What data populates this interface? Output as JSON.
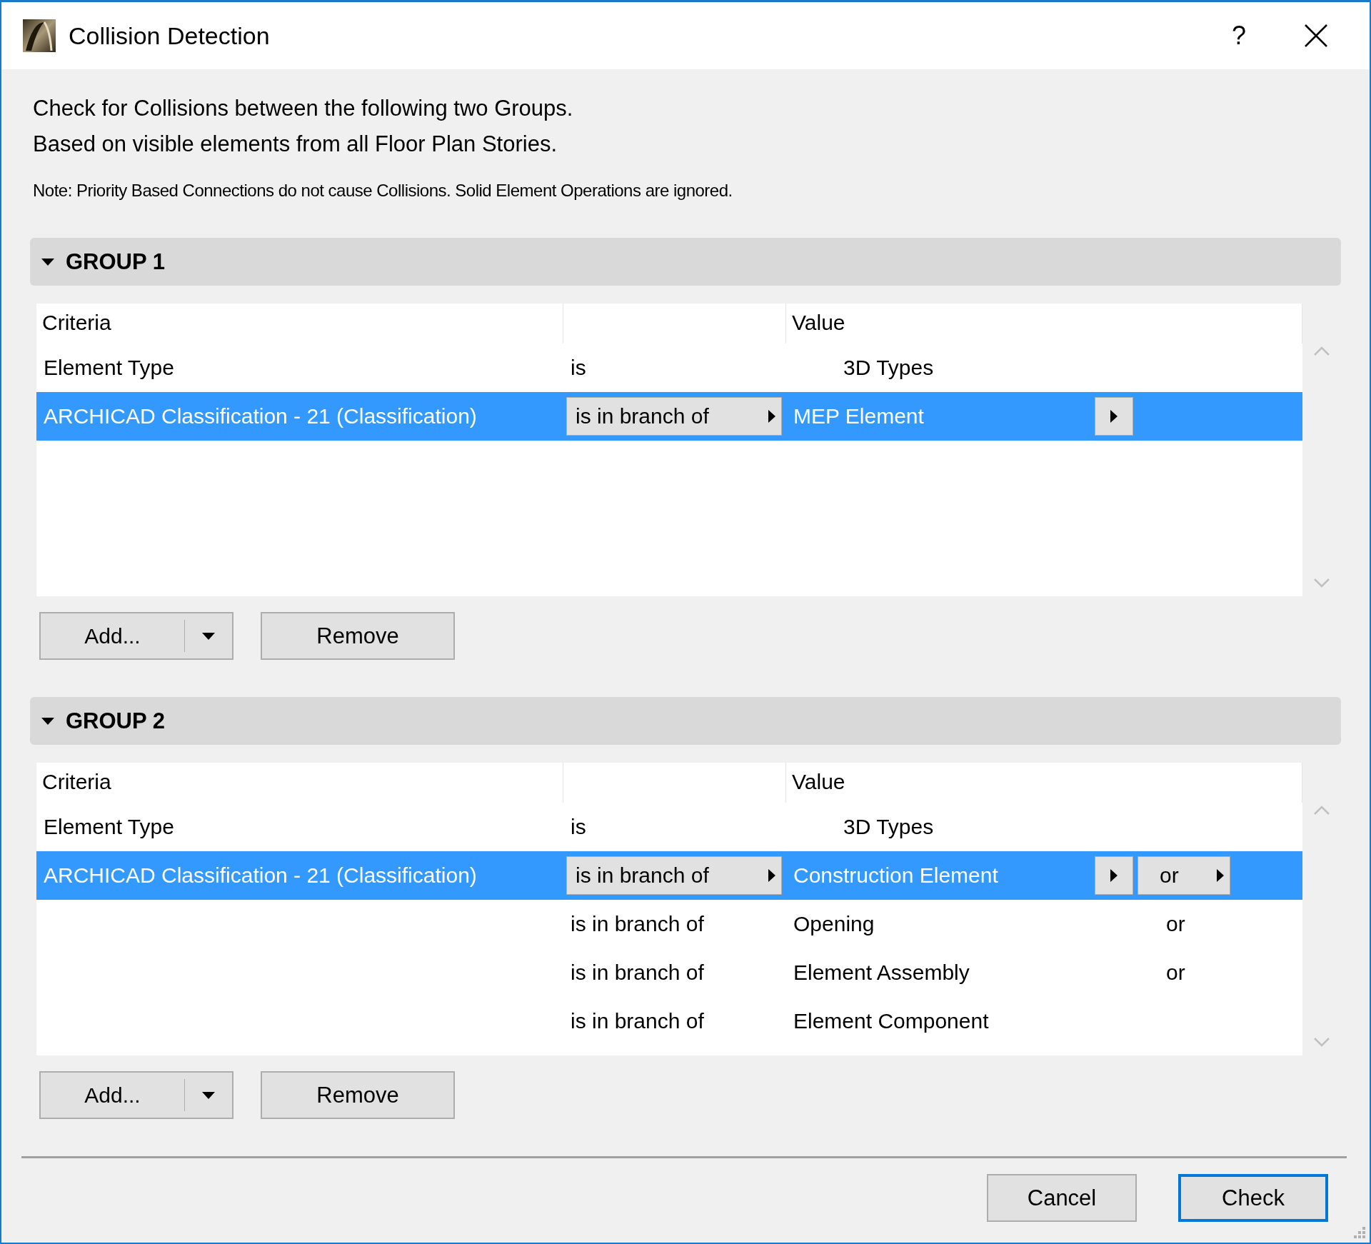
{
  "window": {
    "title": "Collision Detection",
    "help": "?"
  },
  "intro": [
    "Check for Collisions between the following two Groups.",
    "Based on visible elements from all Floor Plan Stories."
  ],
  "note": "Note: Priority Based Connections do not cause Collisions. Solid Element Operations are ignored.",
  "groups": [
    {
      "title": "GROUP 1",
      "expanded": true,
      "columns": {
        "criteria": "Criteria",
        "value": "Value"
      },
      "rows": [
        {
          "criteria": "Element Type",
          "operator": "is",
          "value": "3D Types",
          "selected": false
        },
        {
          "criteria": "ARCHICAD Classification - 21 (Classification)",
          "operator": "is in branch of",
          "value": "MEP Element",
          "selected": true
        }
      ],
      "add": "Add...",
      "remove": "Remove"
    },
    {
      "title": "GROUP 2",
      "expanded": true,
      "columns": {
        "criteria": "Criteria",
        "value": "Value"
      },
      "rows": [
        {
          "criteria": "Element Type",
          "operator": "is",
          "value": "3D Types",
          "selected": false
        },
        {
          "criteria": "ARCHICAD Classification - 21 (Classification)",
          "operator": "is in branch of",
          "value": "Construction Element",
          "conjunction": "or",
          "selected": true
        },
        {
          "operator": "is in branch of",
          "value": "Opening",
          "conjunction": "or",
          "selected": false
        },
        {
          "operator": "is in branch of",
          "value": "Element Assembly",
          "conjunction": "or",
          "selected": false
        },
        {
          "operator": "is in branch of",
          "value": "Element Component",
          "selected": false
        }
      ],
      "add": "Add...",
      "remove": "Remove"
    }
  ],
  "buttons": {
    "cancel": "Cancel",
    "check": "Check"
  }
}
